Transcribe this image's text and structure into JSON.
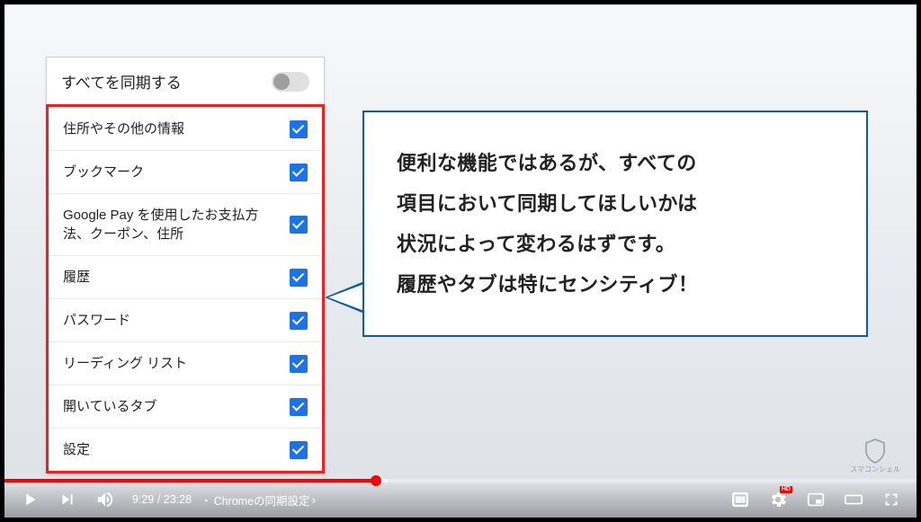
{
  "settings": {
    "header": "すべてを同期する",
    "items": [
      {
        "label": "住所やその他の情報"
      },
      {
        "label": "ブックマーク"
      },
      {
        "label": "Google Pay を使用したお支払方法、クーポン、住所"
      },
      {
        "label": "履歴"
      },
      {
        "label": "パスワード"
      },
      {
        "label": "リーディング リスト"
      },
      {
        "label": "開いているタブ"
      },
      {
        "label": "設定"
      }
    ]
  },
  "bubble": {
    "line1": "便利な機能ではあるが、すべての",
    "line2": "項目において同期してほしいかは",
    "line3": "状況によって変わるはずです。",
    "line4": "履歴やタブは特にセンシティブ！"
  },
  "watermark": {
    "text": "スマコンシェル"
  },
  "player": {
    "current_time": "9:29",
    "duration": "23:28",
    "separator": " / ",
    "chapter_prefix": "・",
    "chapter": "Chromeの同期設定",
    "hd": "HD"
  }
}
